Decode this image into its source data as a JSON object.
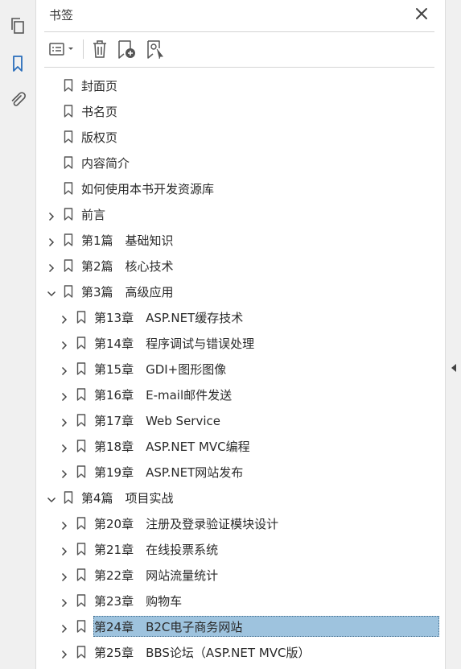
{
  "panel": {
    "title": "书签",
    "close_icon": "close-icon"
  },
  "left_rail": {
    "icons": [
      "pages-icon",
      "bookmark-icon",
      "attachment-icon"
    ],
    "active": "bookmark-icon"
  },
  "toolbar": {
    "icons": [
      "options-menu-icon",
      "delete-bookmark-icon",
      "new-bookmark-icon",
      "bookmark-from-selection-icon"
    ]
  },
  "colors": {
    "selection": "#9ec3de",
    "accent": "#2a6ebb"
  },
  "bookmarks": [
    {
      "label": "封面页",
      "level": 0,
      "expander": "none"
    },
    {
      "label": "书名页",
      "level": 0,
      "expander": "none"
    },
    {
      "label": "版权页",
      "level": 0,
      "expander": "none"
    },
    {
      "label": "内容简介",
      "level": 0,
      "expander": "none"
    },
    {
      "label": "如何使用本书开发资源库",
      "level": 0,
      "expander": "none"
    },
    {
      "label": "前言",
      "level": 0,
      "expander": "collapsed"
    },
    {
      "label": "第1篇　基础知识",
      "level": 0,
      "expander": "collapsed"
    },
    {
      "label": "第2篇　核心技术",
      "level": 0,
      "expander": "collapsed"
    },
    {
      "label": "第3篇　高级应用",
      "level": 0,
      "expander": "expanded"
    },
    {
      "label": "第13章　ASP.NET缓存技术",
      "level": 1,
      "expander": "collapsed"
    },
    {
      "label": "第14章　程序调试与错误处理",
      "level": 1,
      "expander": "collapsed"
    },
    {
      "label": "第15章　GDI+图形图像",
      "level": 1,
      "expander": "collapsed"
    },
    {
      "label": "第16章　E-mail邮件发送",
      "level": 1,
      "expander": "collapsed"
    },
    {
      "label": "第17章　Web Service",
      "level": 1,
      "expander": "collapsed"
    },
    {
      "label": "第18章　ASP.NET MVC编程",
      "level": 1,
      "expander": "collapsed"
    },
    {
      "label": "第19章　ASP.NET网站发布",
      "level": 1,
      "expander": "collapsed"
    },
    {
      "label": "第4篇　项目实战",
      "level": 0,
      "expander": "expanded"
    },
    {
      "label": "第20章　注册及登录验证模块设计",
      "level": 1,
      "expander": "collapsed"
    },
    {
      "label": "第21章　在线投票系统",
      "level": 1,
      "expander": "collapsed"
    },
    {
      "label": "第22章　网站流量统计",
      "level": 1,
      "expander": "collapsed"
    },
    {
      "label": "第23章　购物车",
      "level": 1,
      "expander": "collapsed"
    },
    {
      "label": "第24章　B2C电子商务网站",
      "level": 1,
      "expander": "collapsed",
      "selected": true
    },
    {
      "label": "第25章　BBS论坛（ASP.NET MVC版）",
      "level": 1,
      "expander": "collapsed"
    }
  ]
}
